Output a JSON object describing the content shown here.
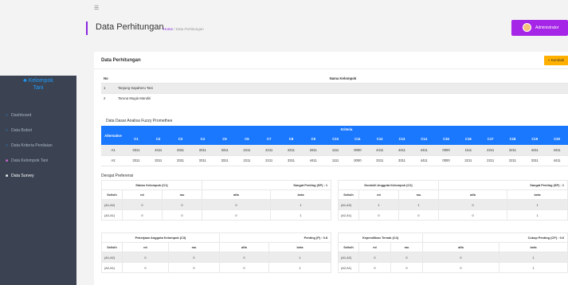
{
  "sidebar": {
    "brand_line1": "Kelompok",
    "brand_line2": "Tani",
    "items": [
      {
        "label": "Dashboard",
        "icon": "dashboard-icon"
      },
      {
        "label": "Data Bobot",
        "icon": "weight-icon"
      },
      {
        "label": "Data Kriteria Penilaian",
        "icon": "criteria-icon"
      },
      {
        "label": "Data Kelompok Tani",
        "icon": "group-icon"
      },
      {
        "label": "Data Survey",
        "icon": "survey-icon"
      }
    ]
  },
  "header": {
    "title": "Data Perhitungan",
    "breadcrumb_home": "Home",
    "breadcrumb_sep": " / ",
    "breadcrumb_current": "Data Perhitungan",
    "user": "Administrator"
  },
  "card": {
    "title": "Data Perhitungan",
    "back_label": "« Kembali"
  },
  "kelompok": {
    "col_no": "No",
    "col_name": "Nama Kelompok",
    "rows": [
      {
        "no": "1",
        "name": "Tanjung Sapaheru Tani"
      },
      {
        "no": "2",
        "name": "Taruna Mugia Mandiri"
      }
    ]
  },
  "alternatif": {
    "section_title": "Data Dasar Analisa Fuzzy Promethee",
    "col_alt": "Alternative",
    "col_group": "Kriteria",
    "criteria": [
      "C1",
      "C2",
      "C3",
      "C4",
      "C5",
      "C6",
      "C7",
      "C8",
      "C9",
      "C10",
      "C11",
      "C12",
      "C13",
      "C14",
      "C15",
      "C16",
      "C17",
      "C18",
      "C19",
      "C20"
    ],
    "rows": [
      {
        "name": "A1",
        "values": [
          "3311",
          "4411",
          "3311",
          "3311",
          "3311",
          "2211",
          "2211",
          "2211",
          "3311",
          "1111",
          "0000",
          "4411",
          "4411",
          "4411",
          "0000",
          "1111",
          "2211",
          "2211",
          "4411",
          "4411"
        ]
      },
      {
        "name": "A2",
        "values": [
          "3311",
          "3311",
          "3311",
          "3311",
          "3311",
          "2211",
          "2211",
          "3311",
          "4411",
          "1111",
          "0000",
          "3311",
          "3311",
          "4411",
          "0000",
          "2211",
          "2211",
          "2211",
          "3311",
          "4411"
        ]
      }
    ]
  },
  "preferensi": {
    "section_title": "Derajat Preferensi",
    "tables": [
      {
        "name": "Status Kelompok (C1)",
        "kind": "Sangat Penting (SP) : 1",
        "cols": [
          "Selisih",
          "ml",
          "mu",
          "alfa",
          "beta"
        ],
        "rows": [
          [
            "(A1,A2)",
            "0",
            "0",
            "0",
            "1"
          ],
          [
            "(A2,A1)",
            "0",
            "0",
            "0",
            "1"
          ]
        ]
      },
      {
        "name": "Domisili Anggota Kelompok (C2)",
        "kind": "Sangat Penting (SP) : 1",
        "cols": [
          "Selisih",
          "ml",
          "mu",
          "alfa",
          "beta"
        ],
        "rows": [
          [
            "(A1,A2)",
            "1",
            "1",
            "0",
            "1"
          ],
          [
            "(A2,A1)",
            "0",
            "0",
            "0",
            "1"
          ]
        ]
      },
      {
        "name": "Pekerjaan Anggota Kelompok (C3)",
        "kind": "Penting (P) : 0.8",
        "cols": [
          "Selisih",
          "ml",
          "mu",
          "alfa",
          "beta"
        ],
        "rows": [
          [
            "(A1,A2)",
            "0",
            "0",
            "0",
            "1"
          ],
          [
            "(A2,A1)",
            "0",
            "0",
            "0",
            "1"
          ]
        ]
      },
      {
        "name": "Kepemilikan Ternak (C4)",
        "kind": "Cukup Penting (CP) : 0.6",
        "cols": [
          "Selisih",
          "ml",
          "mu",
          "alfa",
          "beta"
        ],
        "rows": [
          [
            "(A1,A2)",
            "0",
            "0",
            "0",
            "1"
          ],
          [
            "(A2,A1)",
            "0",
            "0",
            "0",
            "1"
          ]
        ]
      }
    ]
  }
}
